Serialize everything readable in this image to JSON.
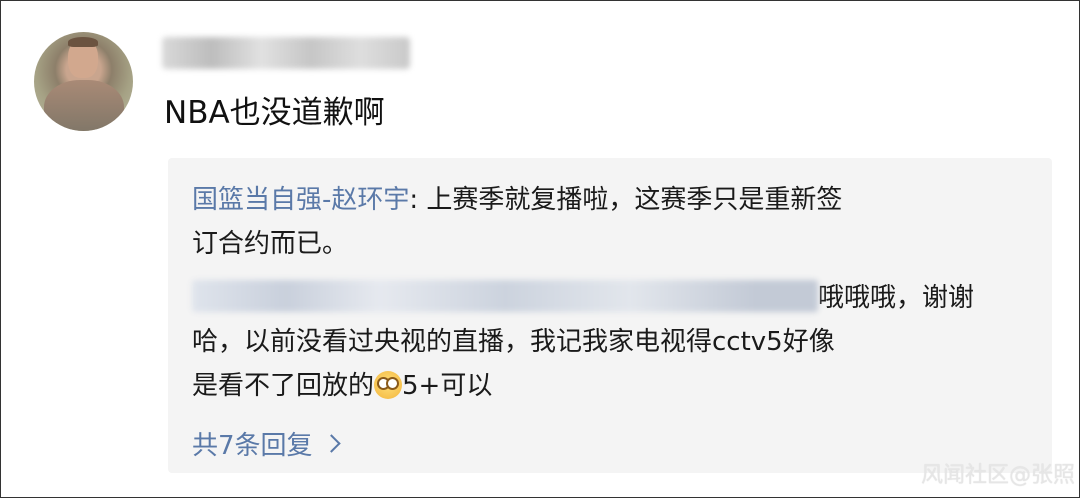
{
  "comment": {
    "text": "NBA也没道歉啊"
  },
  "reply_box": {
    "reply1": {
      "author": "国篮当自强-赵环宇",
      "separator": ": ",
      "line1": "上赛季就复播啦，这赛季只是重新签",
      "line2": "订合约而已。"
    },
    "reply2": {
      "line1_suffix": "哦哦哦，谢谢",
      "line2": "哈，以前没看过央视的直播，我记我家电视得cctv5好像",
      "line3_before_emoji": "是看不了回放的",
      "emoji_icon": "flushed-face-icon",
      "line3_after_emoji": "5+可以"
    },
    "more_replies_label": "共7条回复"
  },
  "watermark": "风闻社区@张照"
}
